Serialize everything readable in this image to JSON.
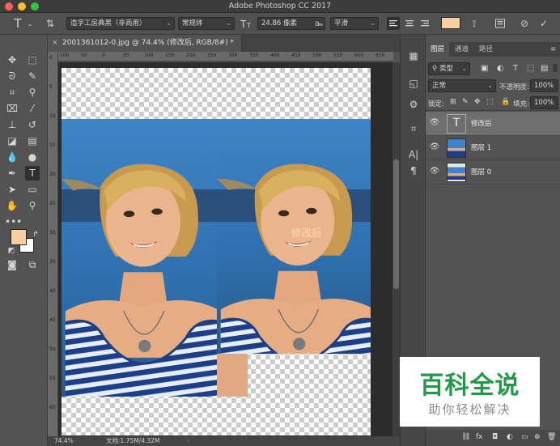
{
  "app": {
    "title": "Adobe Photoshop CC 2017"
  },
  "options_bar": {
    "font_family": "造字工房典黑（非商用）",
    "font_style": "常规体",
    "font_size": "24.86 像素",
    "antialias": "平滑",
    "text_color": "#f7cfa3"
  },
  "document": {
    "tab_title": "20013610​12-0.jpg @ 74.4% (修改后, RGB/8#) *",
    "overlay_text": "修改后",
    "zoom": "74.4%",
    "file_info": "文档:1.75M/4.32M"
  },
  "rulers": {
    "h": [
      "100",
      "50",
      "0",
      "50",
      "100",
      "150",
      "200",
      "250",
      "300",
      "350",
      "400",
      "450",
      "500",
      "550",
      "600",
      "650"
    ],
    "v": [
      "0",
      "5",
      "10",
      "15",
      "20",
      "25",
      "30",
      "35",
      "40",
      "45",
      "50",
      "55",
      "60"
    ]
  },
  "colors": {
    "foreground": "#f7cfa3",
    "background": "#ffffff"
  },
  "layers_panel": {
    "tabs": [
      "图层",
      "通道",
      "路径"
    ],
    "filter_label": "类型",
    "blend_mode": "正常",
    "opacity_label": "不透明度:",
    "opacity_value": "100%",
    "lock_label": "锁定:",
    "fill_label": "填充:",
    "fill_value": "100%",
    "layers": [
      {
        "name": "修改后",
        "type": "text"
      },
      {
        "name": "图层 1",
        "type": "image"
      },
      {
        "name": "图层 0",
        "type": "image"
      }
    ]
  },
  "watermark": {
    "title": "百科全说",
    "subtitle": "助你轻松解决"
  }
}
